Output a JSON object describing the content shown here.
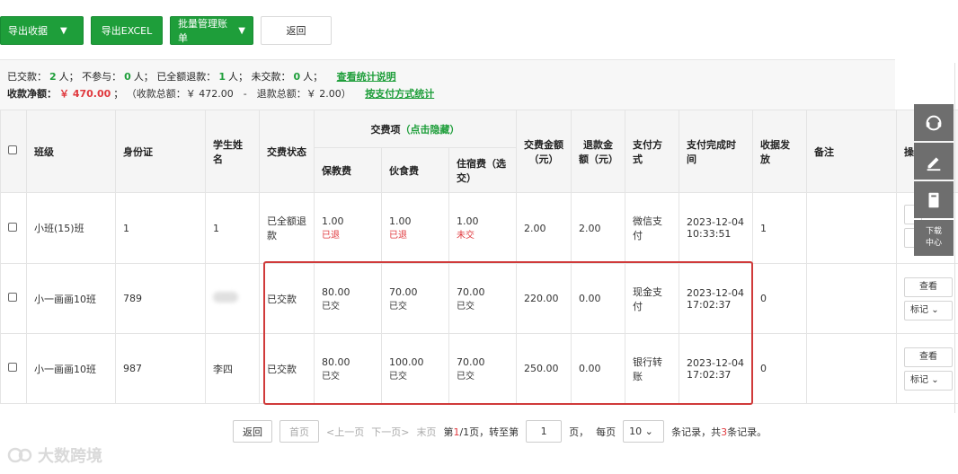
{
  "toolbar": {
    "export_receipt": "导出收据",
    "export_excel": "导出EXCEL",
    "batch_manage": "批量管理账单",
    "back": "返回"
  },
  "summary": {
    "paid_label": "已交款：",
    "paid_count": "2",
    "person": "人；",
    "not_participate_label": "不参与：",
    "not_participate_count": "0",
    "full_refund_label": "已全额退款：",
    "full_refund_count": "1",
    "unpaid_label": "未交款：",
    "unpaid_count": "0",
    "view_stats_link": "查看统计说明",
    "net_label": "收款净额：",
    "net_value": "￥ 470.00",
    "semicolon": "；",
    "detail": "（收款总额：￥ 472.00　-　退款总额：￥ 2.00）",
    "by_pay_method_link": "按支付方式统计"
  },
  "table": {
    "headers": {
      "class": "班级",
      "id_card": "身份证",
      "student": "学生姓名",
      "status": "交费状态",
      "fee_items": "交费项",
      "toggle": "（点击隐藏）",
      "fee1": "保教费",
      "fee2": "伙食费",
      "fee3": "住宿费（选交）",
      "amount": "交费金额（元）",
      "refund": "退款金额（元）",
      "pay_method": "支付方式",
      "pay_time": "支付完成时间",
      "receipt": "收据发放",
      "remark": "备注",
      "op": "操"
    },
    "rows": [
      {
        "class": "小班(15)班",
        "id_card": "1",
        "student": "1",
        "status": "已全额退款",
        "fee1": "1.00",
        "fee1_state": "已退",
        "fee2": "1.00",
        "fee2_state": "已退",
        "fee3": "1.00",
        "fee3_state": "未交",
        "amount": "2.00",
        "refund": "2.00",
        "pay_method": "微信支付",
        "pay_date": "2023-12-04",
        "pay_clock": "10:33:51",
        "receipt": "1"
      },
      {
        "class": "小一画画10班",
        "id_card": "789",
        "student": "",
        "status": "已交款",
        "fee1": "80.00",
        "fee1_state": "已交",
        "fee2": "70.00",
        "fee2_state": "已交",
        "fee3": "70.00",
        "fee3_state": "已交",
        "amount": "220.00",
        "refund": "0.00",
        "pay_method": "现金支付",
        "pay_date": "2023-12-04",
        "pay_clock": "17:02:37",
        "receipt": "0",
        "view": "查看",
        "mark": "标记"
      },
      {
        "class": "小一画画10班",
        "id_card": "987",
        "student": "李四",
        "status": "已交款",
        "fee1": "80.00",
        "fee1_state": "已交",
        "fee2": "100.00",
        "fee2_state": "已交",
        "fee3": "70.00",
        "fee3_state": "已交",
        "amount": "250.00",
        "refund": "0.00",
        "pay_method": "银行转账",
        "pay_date": "2023-12-04",
        "pay_clock": "17:02:37",
        "receipt": "0",
        "view": "查看",
        "mark": "标记"
      }
    ]
  },
  "pager": {
    "back": "返回",
    "first": "首页",
    "prev": "<上一页",
    "next": "下一页>",
    "last": "末页",
    "page_prefix": "第",
    "page_current": "1",
    "page_mid": "/1页，",
    "goto": "转至第",
    "goto_value": "1",
    "page_unit": "页，",
    "per_page": "每页",
    "per_page_value": "10",
    "records_prefix": "条记录，共",
    "records_total": "3",
    "records_suffix": "条记录。"
  },
  "side": {
    "download": "下载",
    "center": "中心"
  },
  "watermark": "大数跨境",
  "colors": {
    "accent": "#1e9e3a",
    "danger": "#e0393e"
  }
}
